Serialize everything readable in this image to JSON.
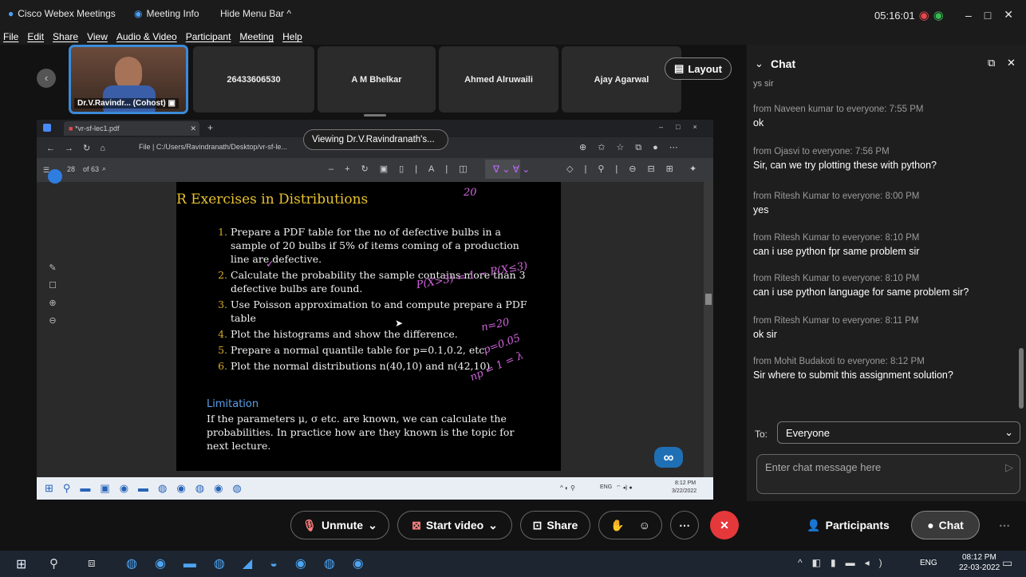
{
  "titlebar": {
    "app": "Cisco Webex Meetings",
    "meeting_info": "Meeting Info",
    "hide_menu": "Hide Menu Bar ^",
    "clock": "05:16:01"
  },
  "menu": [
    "File",
    "Edit",
    "Share",
    "View",
    "Audio & Video",
    "Participant",
    "Meeting",
    "Help"
  ],
  "participants": {
    "self": "Dr.V.Ravindr... (Cohost)",
    "p1": "26433606530",
    "p2": "A M Bhelkar",
    "p3": "Ahmed Alruwaili",
    "p4": "Ajay Agarwal",
    "layout": "Layout"
  },
  "viewing": "Viewing Dr.V.Ravindranath's...",
  "browser": {
    "tab": "*vr-sf-lec1.pdf",
    "address": "File | C:/Users/Ravindranath/Desktop/vr-sf-le...",
    "page": "28",
    "of": "of 63"
  },
  "slide": {
    "title": "R Exercises in Distributions",
    "items": [
      "Prepare a PDF table for the no of defective bulbs in a sample of 20 bulbs if 5% of items coming of a production line are defective.",
      "Calculate the probability the sample contains more than 3 defective bulbs are found.",
      "Use Poisson approximation to and compute prepare a PDF table",
      "Plot the histograms and show the difference.",
      "Prepare a normal quantile table for p=0.1,0.2, etc.",
      "Plot the normal distributions n(40,10) and n(42,10)"
    ],
    "limitation_title": "Limitation",
    "limitation_text": "If the parameters μ, σ etc. are known, we can calculate the probabilities. In practice how are they known is the topic for next lecture.",
    "handwriting": [
      "20",
      "P(X>3) = 1 − P(X≤3)",
      "n=20",
      "p=0.05",
      "np = 1 = λ"
    ]
  },
  "inner_taskbar": {
    "lang": "ENG",
    "time": "8:12 PM",
    "date": "3/22/2022"
  },
  "chat": {
    "title": "Chat",
    "top_partial": "ys sir",
    "messages": [
      {
        "from": "from Naveen kumar to everyone:   7:55 PM",
        "text": "ok"
      },
      {
        "from": "from Ojasvi to everyone:   7:56 PM",
        "text": "Sir, can we try plotting these with python?"
      },
      {
        "from": "from Ritesh Kumar to everyone:   8:00 PM",
        "text": "yes"
      },
      {
        "from": "from Ritesh Kumar to everyone:   8:10 PM",
        "text": "can i use python fpr same problem sir"
      },
      {
        "from": "from Ritesh Kumar to everyone:   8:10 PM",
        "text": "can i use python language for same problem sir?"
      },
      {
        "from": "from Ritesh Kumar to everyone:   8:11 PM",
        "text": "ok sir"
      },
      {
        "from": "from Mohit Budakoti to everyone:   8:12 PM",
        "text": "Sir where to submit this assignment solution?"
      }
    ],
    "to_label": "To:",
    "to_value": "Everyone",
    "placeholder": "Enter chat message here"
  },
  "controls": {
    "unmute": "Unmute",
    "start_video": "Start video",
    "share": "Share",
    "participants": "Participants",
    "chat": "Chat"
  },
  "wintaskbar": {
    "lang": "ENG",
    "time": "08:12 PM",
    "date": "22-03-2022"
  }
}
